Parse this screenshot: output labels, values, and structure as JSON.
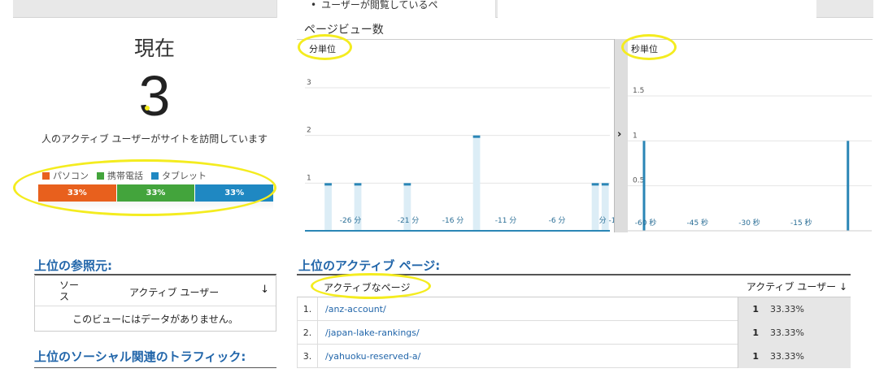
{
  "topbar": {
    "bullet_text": "ユーザーが閲覧しているペ"
  },
  "realtime": {
    "now_label": "現在",
    "active_count": "3",
    "description": "人のアクティブ ユーザーがサイトを訪問しています"
  },
  "devices": {
    "legend": [
      {
        "label": "パソコン",
        "color": "#e8601d"
      },
      {
        "label": "携帯電話",
        "color": "#43a43c"
      },
      {
        "label": "タブレット",
        "color": "#1f88c2"
      }
    ],
    "segments": [
      {
        "label": "33%",
        "share": 0.3333,
        "color": "#e8601d"
      },
      {
        "label": "33%",
        "share": 0.3333,
        "color": "#43a43c"
      },
      {
        "label": "33%",
        "share": 0.3334,
        "color": "#1f88c2"
      }
    ]
  },
  "pageviews": {
    "title": "ページビュー数",
    "minute_label": "分単位",
    "second_label": "秒単位"
  },
  "chart_data": [
    {
      "type": "bar",
      "title": "分単位",
      "ylim": [
        0,
        3
      ],
      "yticks": [
        "1",
        "2",
        "3"
      ],
      "xticks": [
        "-26 分",
        "-21 分",
        "-16 分",
        "-11 分",
        "-6 分",
        "分 -1"
      ],
      "x": [
        -29,
        -28,
        -27,
        -26,
        -25,
        -24,
        -23,
        -22,
        -21,
        -20,
        -19,
        -18,
        -17,
        -16,
        -15,
        -14,
        -13,
        -12,
        -11,
        -10,
        -9,
        -8,
        -7,
        -6,
        -5,
        -4,
        -3,
        -2,
        -1,
        0
      ],
      "values": [
        0,
        1,
        0,
        0,
        1,
        0,
        0,
        0,
        0,
        1,
        0,
        0,
        0,
        0,
        0,
        0,
        2,
        0,
        0,
        0,
        0,
        0,
        0,
        0,
        0,
        0,
        0,
        0,
        1,
        1
      ],
      "color": "#2a86b6",
      "fill": "#dcedf6"
    },
    {
      "type": "bar",
      "title": "秒単位",
      "ylim": [
        0,
        1.5
      ],
      "yticks": [
        "0.5",
        "1",
        "1.5"
      ],
      "xticks": [
        "-60 秒",
        "-45 秒",
        "-30 秒",
        "-15 秒"
      ],
      "x": [
        -60,
        -1
      ],
      "values": [
        1,
        1
      ],
      "color": "#2a86b6"
    }
  ],
  "referrers": {
    "title": "上位の参照元:",
    "col_source": "ソース",
    "col_users": "アクティブ ユーザー",
    "sort_icon": "arrow-down-icon",
    "empty_text": "このビューにはデータがありません。"
  },
  "social": {
    "title": "上位のソーシャル関連のトラフィック:"
  },
  "active_pages": {
    "title": "上位のアクティブ ページ:",
    "col_page": "アクティブなページ",
    "col_users": "アクティブ ユーザー",
    "rows": [
      {
        "idx": "1.",
        "url": "/anz-account/",
        "users": "1",
        "pct": "33.33%"
      },
      {
        "idx": "2.",
        "url": "/japan-lake-rankings/",
        "users": "1",
        "pct": "33.33%"
      },
      {
        "idx": "3.",
        "url": "/yahuoku-reserved-a/",
        "users": "1",
        "pct": "33.33%"
      }
    ]
  }
}
